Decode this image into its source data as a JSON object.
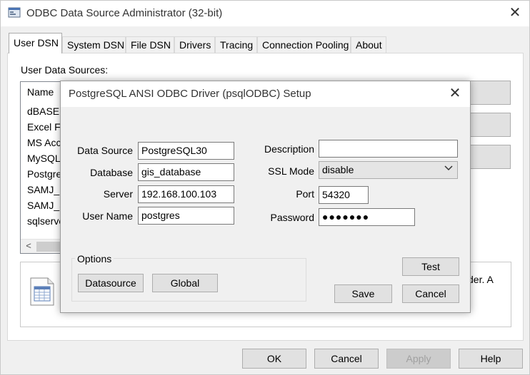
{
  "window": {
    "title": "ODBC Data Source Administrator (32-bit)",
    "close_glyph": "✕"
  },
  "tabs": [
    {
      "label": "User DSN"
    },
    {
      "label": "System DSN"
    },
    {
      "label": "File DSN"
    },
    {
      "label": "Drivers"
    },
    {
      "label": "Tracing"
    },
    {
      "label": "Connection Pooling"
    },
    {
      "label": "About"
    }
  ],
  "user_dsn": {
    "label": "User Data Sources:",
    "column_header": "Name",
    "items": [
      "dBASE I",
      "Excel Fil",
      "MS Acc",
      "MySQL-",
      "PostgreS",
      "SAMJ_D",
      "SAMJ_S",
      "sqlserve"
    ],
    "scroll_left_glyph": "<",
    "info_text": "der.  A"
  },
  "bottom_buttons": {
    "ok": "OK",
    "cancel": "Cancel",
    "apply": "Apply",
    "help": "Help"
  },
  "setup": {
    "title": "PostgreSQL ANSI ODBC Driver (psqlODBC) Setup",
    "labels": {
      "data_source": "Data Source",
      "database": "Database",
      "server": "Server",
      "user_name": "User Name",
      "description": "Description",
      "ssl_mode": "SSL Mode",
      "port": "Port",
      "password": "Password"
    },
    "values": {
      "data_source": "PostgreSQL30",
      "database": "gis_database",
      "server": "192.168.100.103",
      "user_name": "postgres",
      "description": "",
      "ssl_mode": "disable",
      "port": "54320",
      "password": "●●●●●●●"
    },
    "options_label": "Options",
    "buttons": {
      "datasource": "Datasource",
      "global": "Global",
      "test": "Test",
      "save": "Save",
      "cancel": "Cancel"
    }
  },
  "icons": {
    "app": "odbc-app-icon",
    "info": "document-grid-icon",
    "dropdown": "chevron-down-icon"
  }
}
